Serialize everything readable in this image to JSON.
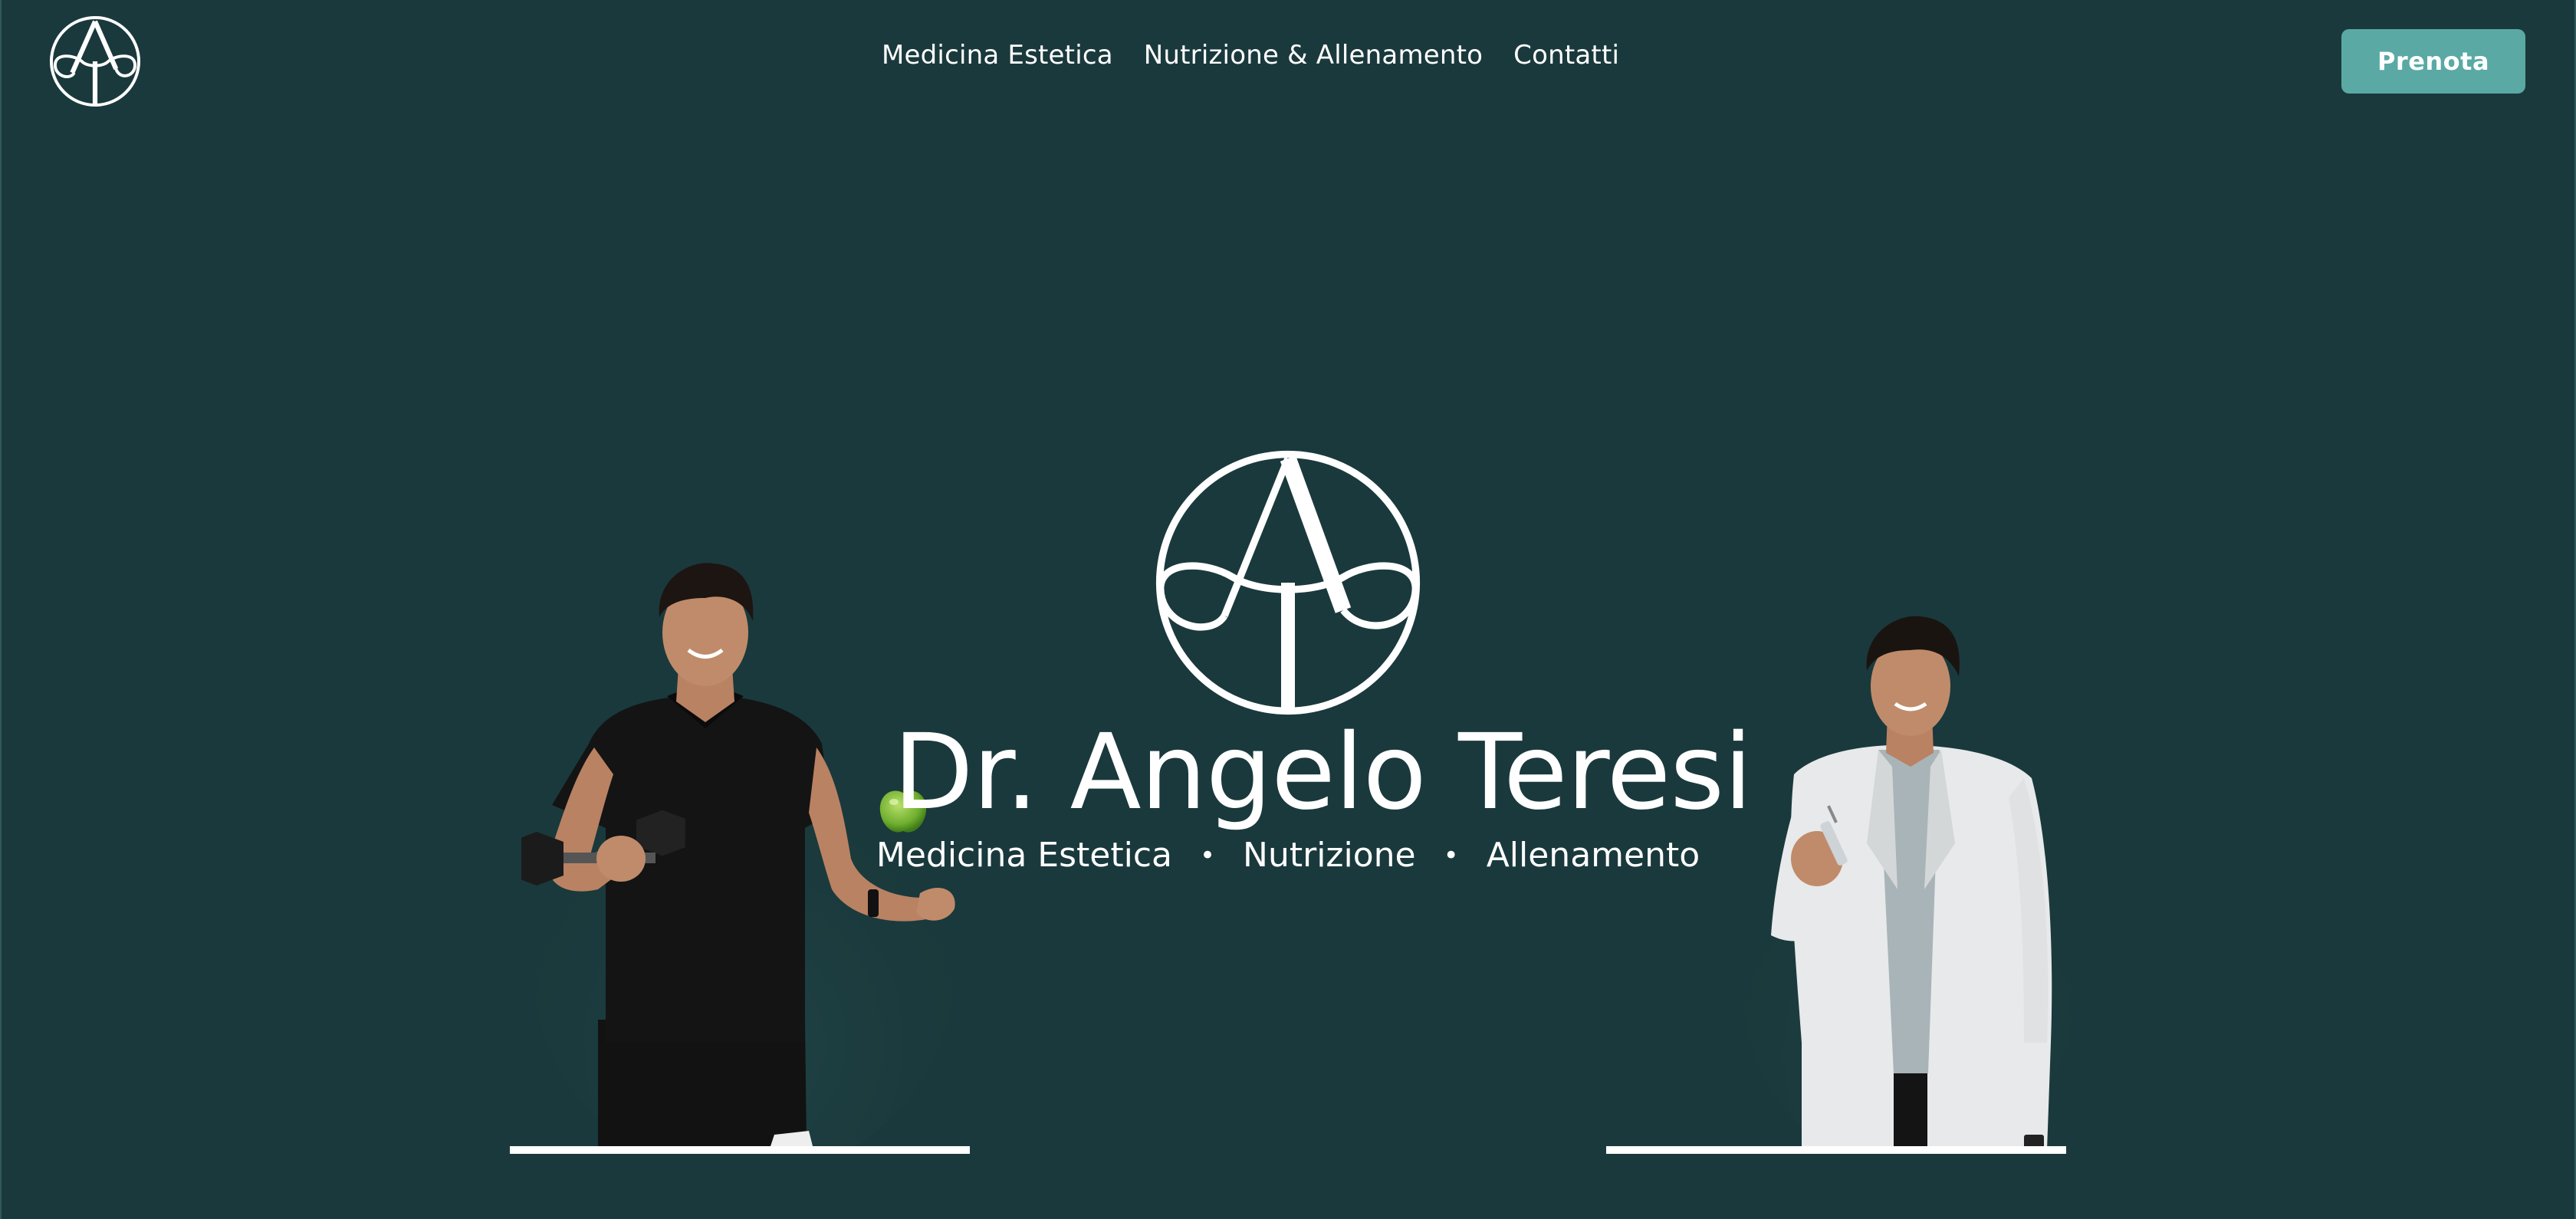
{
  "header": {
    "nav": [
      {
        "label": "Medicina Estetica"
      },
      {
        "label": "Nutrizione & Allenamento"
      },
      {
        "label": "Contatti"
      }
    ],
    "cta_label": "Prenota"
  },
  "hero": {
    "title": "Dr. Angelo Teresi",
    "subtitle": {
      "items": [
        "Medicina Estetica",
        "Nutrizione",
        "Allenamento"
      ],
      "separator": "•"
    }
  },
  "colors": {
    "background": "#1a393c",
    "accent": "#5aa9a4",
    "text": "#ffffff"
  },
  "icons": {
    "brand_logo": "monogram-at-icon",
    "apple": "green-apple-icon",
    "dumbbell": "dumbbell-icon"
  }
}
